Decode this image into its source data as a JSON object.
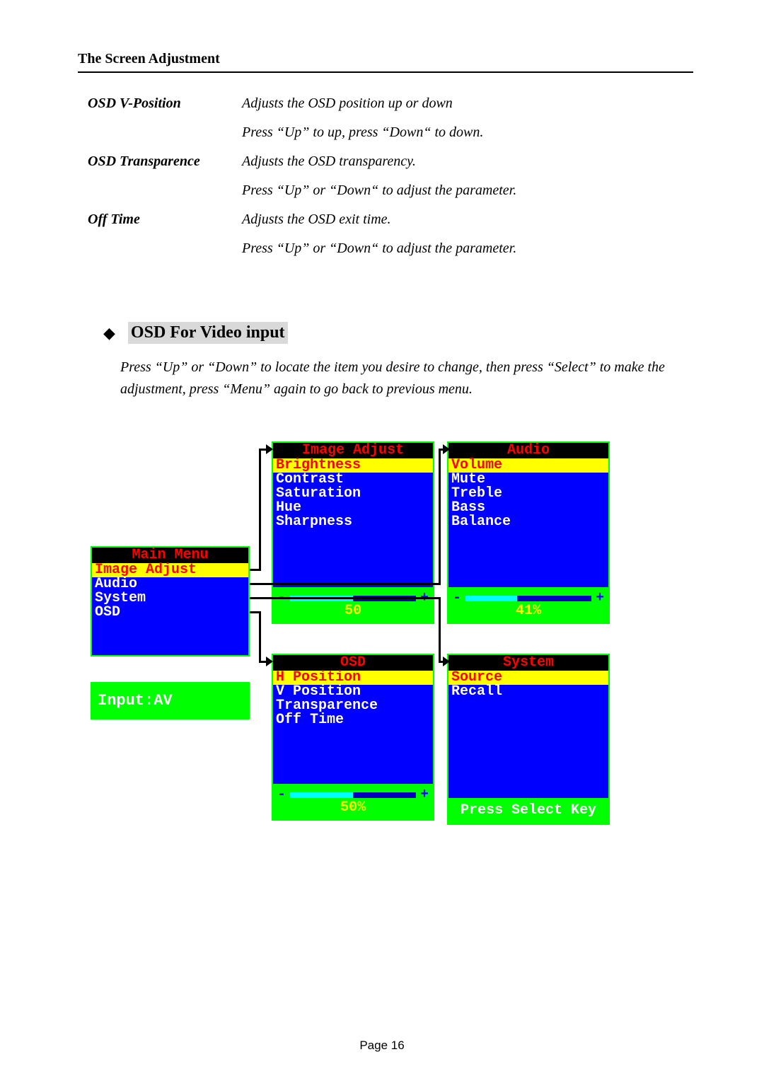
{
  "header": "The Screen Adjustment",
  "defs": {
    "r1_term": "OSD V-Position",
    "r1_d1": "Adjusts the OSD position up or down",
    "r1_d2": "Press “Up” to up, press “Down“ to down.",
    "r2_term": "OSD Transparence",
    "r2_d1": "Adjusts the OSD transparency.",
    "r2_d2": "Press “Up” or “Down“ to adjust the parameter.",
    "r3_term": "Off Time",
    "r3_d1": "Adjusts the OSD exit time.",
    "r3_d2": "Press “Up” or “Down“ to adjust the parameter."
  },
  "section": {
    "title": "OSD For Video input",
    "body": "Press “Up” or “Down” to locate the item you desire to change, then press “Select” to make the adjustment, press “Menu” again to go back to previous menu."
  },
  "main_menu": {
    "title": "Main Menu",
    "selected": "Image Adjust",
    "items": [
      "Audio",
      "System",
      "OSD"
    ]
  },
  "input_label": "Input:AV",
  "image_adjust": {
    "title": "Image Adjust",
    "selected": "Brightness",
    "items": [
      "Contrast",
      "Saturation",
      "Hue",
      "Sharpness"
    ],
    "value": "50",
    "fill_pct": 50
  },
  "audio": {
    "title": "Audio",
    "selected": "Volume",
    "items": [
      "Mute",
      "Treble",
      "Bass",
      "Balance"
    ],
    "value": "41%",
    "fill_pct": 41
  },
  "osd": {
    "title": "OSD",
    "selected": "H Position",
    "items": [
      "V Position",
      "Transparence",
      "Off Time"
    ],
    "value": "50%",
    "fill_pct": 50
  },
  "system": {
    "title": "System",
    "selected": "Source",
    "items": [
      "Recall"
    ],
    "footer": "Press Select Key"
  },
  "page_number": "Page 16",
  "symbols": {
    "minus": "-",
    "plus": "+"
  }
}
